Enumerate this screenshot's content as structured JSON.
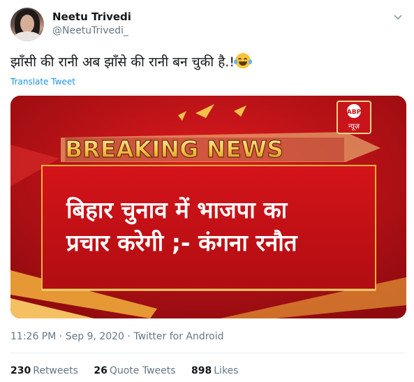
{
  "author": {
    "name": "Neetu Trivedi",
    "handle": "@NeetuTrivedi_"
  },
  "tweet": {
    "text": "झाँसी की रानी अब झाँसे की रानी बन चुकी है.!",
    "emoji": "face-with-tears-of-joy",
    "translate_label": "Translate Tweet"
  },
  "media": {
    "banner": "BREAKING NEWS",
    "channel_logo": "ABP",
    "channel_logo_sub": "न्यूज़",
    "headline_line1": "बिहार चुनाव में भाजपा का",
    "headline_line2": "प्रचार करेगी ;- कंगना रनौत"
  },
  "meta": {
    "time": "11:26 PM",
    "date": "Sep 9, 2020",
    "source": "Twitter for Android",
    "separator": "·"
  },
  "stats": {
    "retweets_count": "230",
    "retweets_label": "Retweets",
    "quotes_count": "26",
    "quotes_label": "Quote Tweets",
    "likes_count": "898",
    "likes_label": "Likes"
  },
  "colors": {
    "link": "#1b95e0",
    "muted": "#657786",
    "news_red": "#c8141a",
    "banner_gold": "#f5c24a"
  }
}
